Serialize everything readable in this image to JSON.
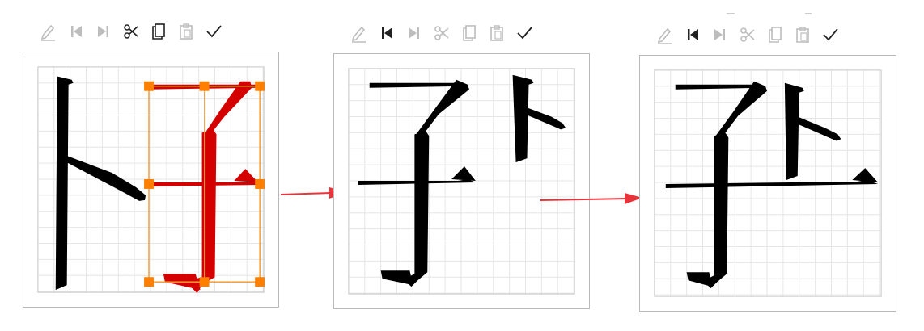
{
  "toolbars": [
    {
      "name": "panel-1",
      "state": [
        "disabled",
        "disabled",
        "disabled",
        "enabled",
        "enabled",
        "disabled",
        "enabled"
      ]
    },
    {
      "name": "panel-2",
      "state": [
        "disabled",
        "enabled",
        "disabled",
        "disabled",
        "disabled",
        "disabled",
        "enabled"
      ]
    },
    {
      "name": "panel-3",
      "state": [
        "disabled",
        "enabled",
        "disabled",
        "disabled",
        "disabled",
        "disabled",
        "enabled"
      ]
    }
  ],
  "toolbar_icons": [
    "pencil-icon",
    "skip-back-icon",
    "skip-forward-icon",
    "scissors-icon",
    "copy-icon",
    "paste-icon",
    "check-icon"
  ],
  "colors": {
    "grid": "#e6e6e6",
    "panel_border": "#b9b9b9",
    "selected_stroke": "#d40000",
    "selection_box": "#f39c33",
    "handle": "#ff7f00",
    "arrow": "#e8333a",
    "icon_enabled": "#222222",
    "icon_disabled": "#bdbdbd"
  },
  "panels": [
    {
      "name": "editor-before",
      "components": [
        "卜",
        "子"
      ],
      "selected_component": "子"
    },
    {
      "name": "editor-moved",
      "components": [
        "子",
        "卜"
      ]
    },
    {
      "name": "editor-result",
      "components": [
        "子",
        "卜"
      ]
    }
  ]
}
